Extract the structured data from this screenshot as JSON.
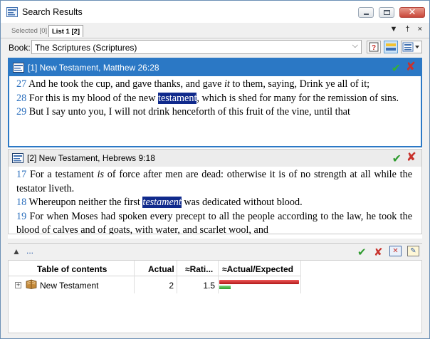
{
  "window": {
    "title": "Search Results"
  },
  "tabs": {
    "selected": "Selected [0]",
    "list": "List 1 [2]",
    "tools": "▼ † ×"
  },
  "book": {
    "label": "Book:",
    "value": "The Scriptures (Scriptures)"
  },
  "results": [
    {
      "header": "[1] New Testament, Matthew 26:28",
      "verses": [
        {
          "num": "27",
          "text": " And he took the cup, and gave thanks, and gave ",
          "italic": "it",
          "rest": " to them, saying, Drink ye all of it;"
        },
        {
          "num": "28",
          "pre": " For this is my blood of the new ",
          "hit": "testament",
          "post": ", which is shed for many for the remission of sins."
        },
        {
          "num": "29",
          "text": " But I say unto you, I will not drink henceforth of this fruit of the vine, until that"
        }
      ]
    },
    {
      "header": "[2] New Testament, Hebrews 9:18",
      "verses": [
        {
          "num": "17",
          "pre": " For a testament ",
          "italic": "is",
          "post": " of force after men are dead: otherwise it is of no strength at all while the testator liveth."
        },
        {
          "num": "18",
          "pre": " Whereupon neither the first ",
          "hit": "testament",
          "post": " was dedicated without blood."
        },
        {
          "num": "19",
          "text": " For when Moses had spoken every precept to all the people according to the law, he took the blood of calves and of goats, with water, and scarlet wool, and"
        }
      ]
    }
  ],
  "bottom": {
    "more": "..."
  },
  "stats": {
    "columns": [
      "Table of contents",
      "Actual",
      "≈Rati...",
      "≈Actual/Expected"
    ],
    "rows": [
      {
        "name": "New Testament",
        "actual": "2",
        "ratio": "1.5",
        "actual_expected": 1.0,
        "expected": 0.14
      }
    ]
  },
  "colors": {
    "accent": "#2b78c5",
    "hit_bg": "#102a8c",
    "verse_num": "#2b6fbd",
    "check": "#2e9b2e",
    "cross": "#c8322c"
  }
}
